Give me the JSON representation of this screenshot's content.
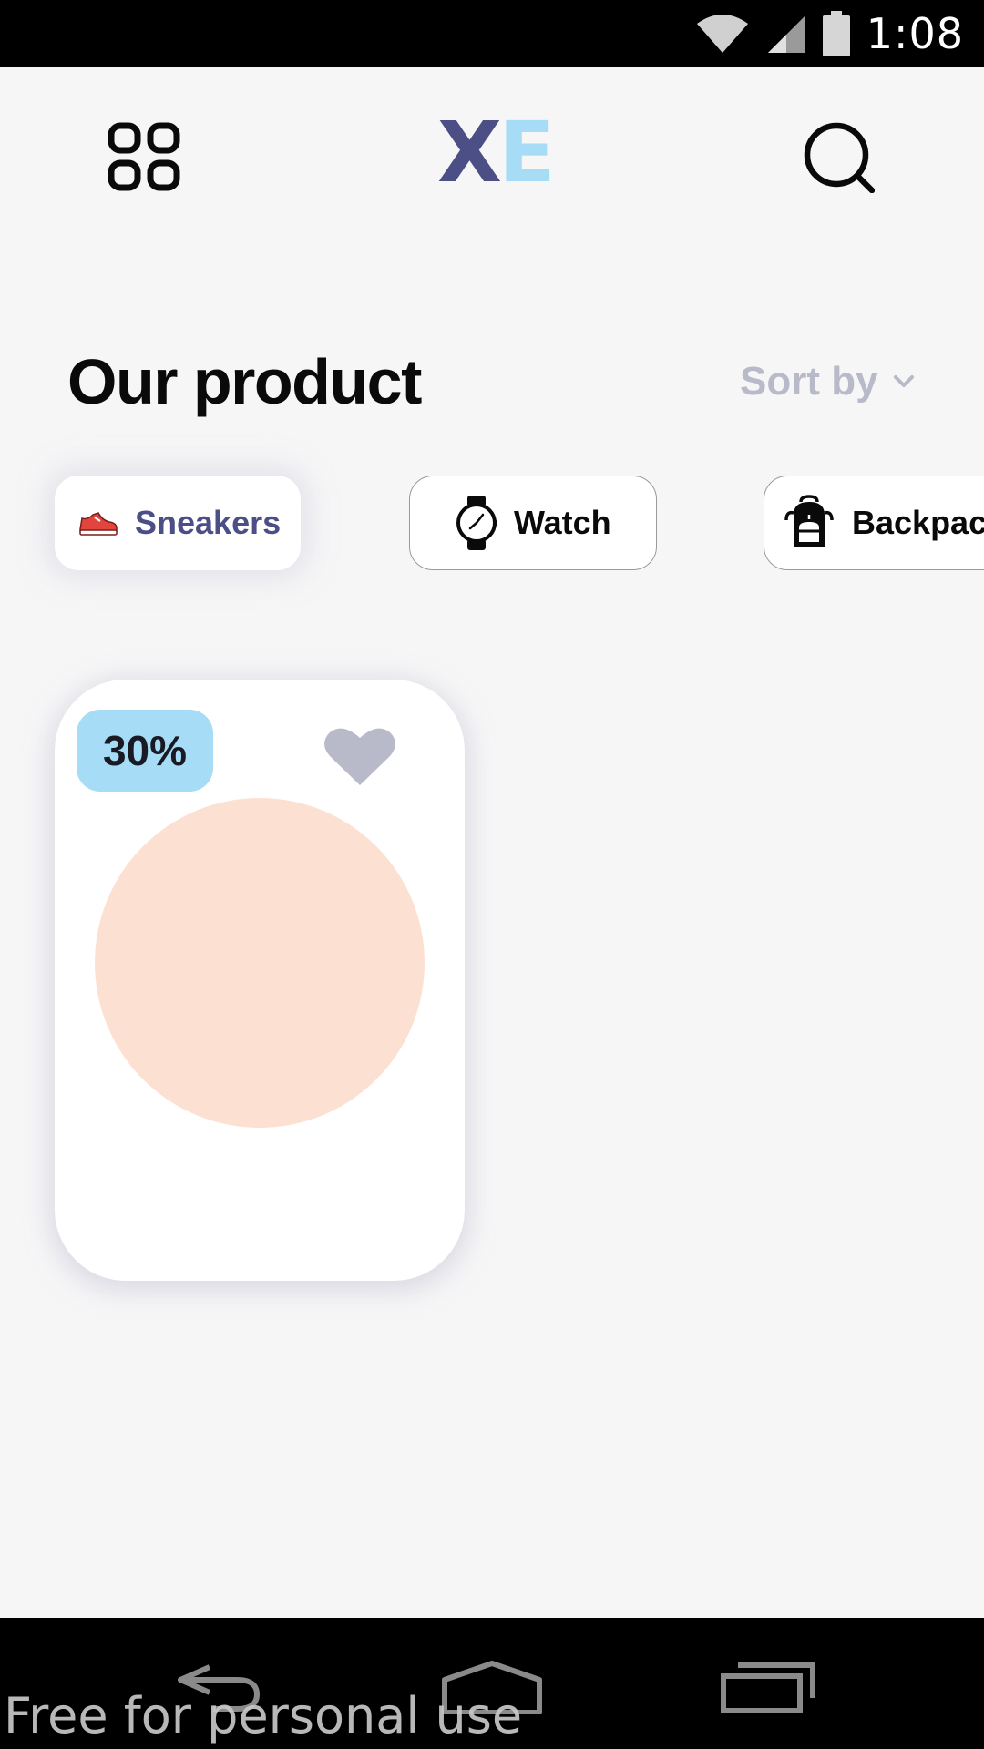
{
  "status_bar": {
    "time": "1:08",
    "icons": [
      "wifi-icon",
      "signal-icon",
      "battery-icon"
    ]
  },
  "app_bar": {
    "menu_icon": "grid-icon",
    "logo": {
      "first": "X",
      "second": "E"
    },
    "search_icon": "search-icon"
  },
  "section": {
    "title": "Our product",
    "sort_label": "Sort by",
    "sort_icon": "chevron-down-icon"
  },
  "categories": [
    {
      "label": "Sneakers",
      "icon": "sneaker-icon",
      "selected": true
    },
    {
      "label": "Watch",
      "icon": "watch-icon",
      "selected": false
    },
    {
      "label": "Backpack",
      "icon": "backpack-icon",
      "selected": false
    }
  ],
  "product_card": {
    "discount": "30%",
    "favorite_icon": "heart-icon"
  },
  "nav_bar": {
    "icons": [
      "back-icon",
      "home-icon",
      "recents-icon"
    ]
  },
  "watermark": "Free for personal use",
  "colors": {
    "brand_dark": "#4b4f86",
    "brand_light": "#a6dcf6",
    "muted": "#b9bac9",
    "product_bg": "#fce1d3",
    "background": "#f6f6f7"
  }
}
